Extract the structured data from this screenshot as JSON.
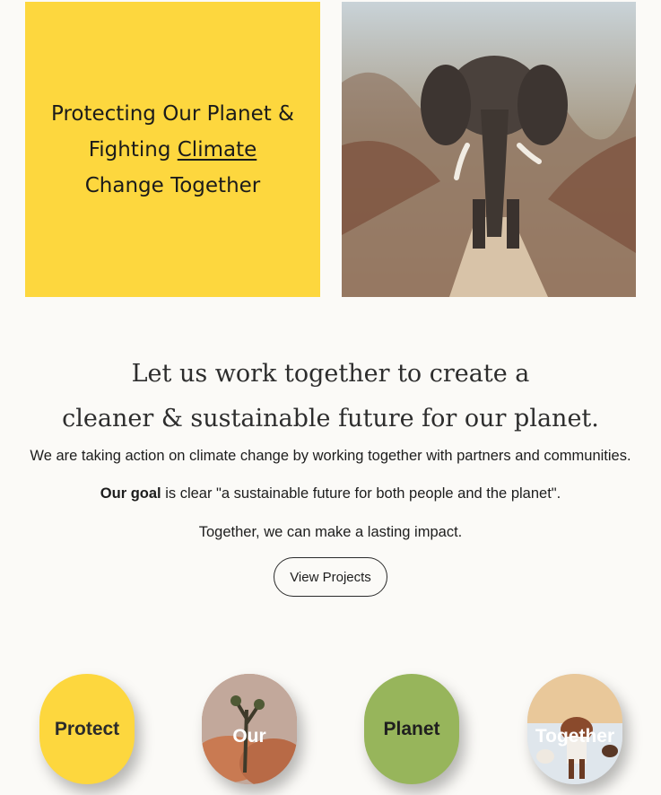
{
  "hero": {
    "line1": "Protecting Our Planet &",
    "line2_prefix": "Fighting ",
    "line2_link": "Climate",
    "line3": "Change Together"
  },
  "headline": {
    "line1": "Let us work together to create a",
    "line2": "cleaner & sustainable future for our planet."
  },
  "body": {
    "p1": "We are taking action on climate change by working together with partners and communities.",
    "p2_bold": "Our goal",
    "p2_rest": " is clear \"a sustainable future for both people and the planet\".",
    "p3": "Together, we can make a lasting impact."
  },
  "cta": {
    "label": "View Projects"
  },
  "pills": {
    "protect": "Protect",
    "our": "Our",
    "planet": "Planet",
    "together": "Together"
  },
  "colors": {
    "yellow": "#fdd73e",
    "green": "#97b55b",
    "background": "#fbfaf7"
  }
}
